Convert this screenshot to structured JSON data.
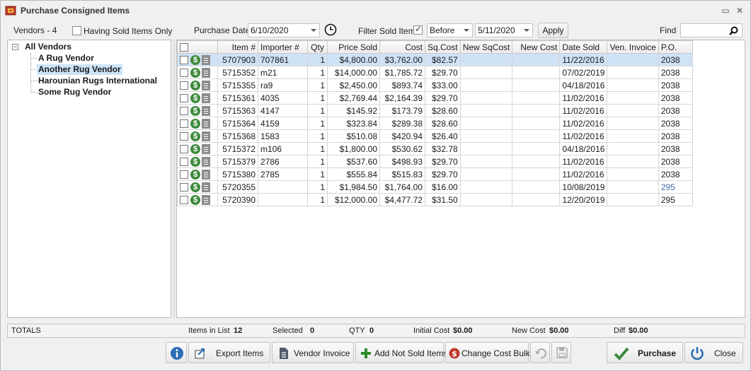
{
  "window": {
    "title": "Purchase Consigned Items",
    "minimize_glyph": "▭",
    "close_glyph": "✕"
  },
  "toolbar": {
    "vendors_label": "Vendors - 4",
    "having_sold_label": "Having Sold Items Only",
    "purchase_date_label": "Purchase Date",
    "purchase_date_value": "6/10/2020",
    "filter_sold_label": "Filter Sold Items",
    "filter_mode_value": "Before",
    "filter_date_value": "5/11/2020",
    "apply_label": "Apply",
    "find_label": "Find",
    "find_value": ""
  },
  "tree": {
    "root": "All Vendors",
    "expander_glyph": "−",
    "children": [
      {
        "label": "A Rug Vendor"
      },
      {
        "label": "Another Rug Vendor"
      },
      {
        "label": "Harounian Rugs International"
      },
      {
        "label": "Some Rug Vendor"
      }
    ]
  },
  "grid": {
    "columns": {
      "item": "Item #",
      "importer": "Importer #",
      "qty": "Qty",
      "price_sold": "Price Sold",
      "cost": "Cost",
      "sq_cost": "Sq.Cost",
      "new_sq_cost": "New SqCost",
      "new_cost": "New Cost",
      "date_sold": "Date Sold",
      "ven_invoice": "Ven. Invoice",
      "po": "P.O."
    },
    "rows": [
      {
        "item": "5707903",
        "importer": "707861",
        "qty": "1",
        "price_sold": "$4,800.00",
        "cost": "$3,762.00",
        "sq_cost": "$82.57",
        "new_sq_cost": "",
        "new_cost": "",
        "date_sold": "11/22/2016",
        "ven_invoice": "",
        "po": "2038"
      },
      {
        "item": "5715352",
        "importer": "m21",
        "qty": "1",
        "price_sold": "$14,000.00",
        "cost": "$1,785.72",
        "sq_cost": "$29.70",
        "new_sq_cost": "",
        "new_cost": "",
        "date_sold": "07/02/2019",
        "ven_invoice": "",
        "po": "2038"
      },
      {
        "item": "5715355",
        "importer": "ra9",
        "qty": "1",
        "price_sold": "$2,450.00",
        "cost": "$893.74",
        "sq_cost": "$33.00",
        "new_sq_cost": "",
        "new_cost": "",
        "date_sold": "04/18/2016",
        "ven_invoice": "",
        "po": "2038"
      },
      {
        "item": "5715361",
        "importer": "4035",
        "qty": "1",
        "price_sold": "$2,769.44",
        "cost": "$2,164.39",
        "sq_cost": "$29.70",
        "new_sq_cost": "",
        "new_cost": "",
        "date_sold": "11/02/2016",
        "ven_invoice": "",
        "po": "2038"
      },
      {
        "item": "5715363",
        "importer": "4147",
        "qty": "1",
        "price_sold": "$145.92",
        "cost": "$173.79",
        "sq_cost": "$28.60",
        "new_sq_cost": "",
        "new_cost": "",
        "date_sold": "11/02/2016",
        "ven_invoice": "",
        "po": "2038"
      },
      {
        "item": "5715364",
        "importer": "4159",
        "qty": "1",
        "price_sold": "$323.84",
        "cost": "$289.38",
        "sq_cost": "$28.60",
        "new_sq_cost": "",
        "new_cost": "",
        "date_sold": "11/02/2016",
        "ven_invoice": "",
        "po": "2038"
      },
      {
        "item": "5715368",
        "importer": "1583",
        "qty": "1",
        "price_sold": "$510.08",
        "cost": "$420.94",
        "sq_cost": "$26.40",
        "new_sq_cost": "",
        "new_cost": "",
        "date_sold": "11/02/2016",
        "ven_invoice": "",
        "po": "2038"
      },
      {
        "item": "5715372",
        "importer": "m106",
        "qty": "1",
        "price_sold": "$1,800.00",
        "cost": "$530.62",
        "sq_cost": "$32.78",
        "new_sq_cost": "",
        "new_cost": "",
        "date_sold": "04/18/2016",
        "ven_invoice": "",
        "po": "2038"
      },
      {
        "item": "5715379",
        "importer": "2786",
        "qty": "1",
        "price_sold": "$537.60",
        "cost": "$498.93",
        "sq_cost": "$29.70",
        "new_sq_cost": "",
        "new_cost": "",
        "date_sold": "11/02/2016",
        "ven_invoice": "",
        "po": "2038"
      },
      {
        "item": "5715380",
        "importer": "2785",
        "qty": "1",
        "price_sold": "$555.84",
        "cost": "$515.83",
        "sq_cost": "$29.70",
        "new_sq_cost": "",
        "new_cost": "",
        "date_sold": "11/02/2016",
        "ven_invoice": "",
        "po": "2038"
      },
      {
        "item": "5720355",
        "importer": "",
        "qty": "1",
        "price_sold": "$1,984.50",
        "cost": "$1,764.00",
        "sq_cost": "$16.00",
        "new_sq_cost": "",
        "new_cost": "",
        "date_sold": "10/08/2019",
        "ven_invoice": "",
        "po": "295"
      },
      {
        "item": "5720390",
        "importer": "",
        "qty": "1",
        "price_sold": "$12,000.00",
        "cost": "$4,477.72",
        "sq_cost": "$31.50",
        "new_sq_cost": "",
        "new_cost": "",
        "date_sold": "12/20/2019",
        "ven_invoice": "",
        "po": "295"
      }
    ]
  },
  "totals": {
    "label": "TOTALS",
    "items_in_list_label": "Items in List",
    "items_in_list_value": "12",
    "selected_label": "Selected",
    "selected_value": "0",
    "qty_label": "QTY",
    "qty_value": "0",
    "initial_cost_label": "Initial Cost",
    "initial_cost_value": "$0.00",
    "new_cost_label": "New Cost",
    "new_cost_value": "$0.00",
    "diff_label": "Diff",
    "diff_value": "$0.00"
  },
  "buttons": {
    "export_items": "Export Items",
    "vendor_invoice": "Vendor Invoice",
    "add_not_sold": "Add Not Sold Items",
    "change_cost_bulk": "Change Cost Bulk",
    "purchase": "Purchase",
    "close": "Close"
  },
  "icons": {
    "info-icon": "info",
    "export-icon": "export",
    "vendor-invoice-icon": "document",
    "add-icon": "plus",
    "change-cost-icon": "dollar-circle",
    "undo-icon": "undo",
    "save-icon": "floppy",
    "purchase-icon": "check",
    "close-icon": "power",
    "dollar-icon": "dollar-circle",
    "doc-icon": "document",
    "calendar-clock-icon": "clock",
    "search-icon": "magnifier"
  },
  "colors": {
    "selected_row": "#cfe2f6",
    "tree_selected": "#cde3f7",
    "dollar_green": "#3e8a3e",
    "change_cost_red": "#c0392b",
    "info_blue": "#2c6db5",
    "link_blue": "#3b6ea5"
  }
}
